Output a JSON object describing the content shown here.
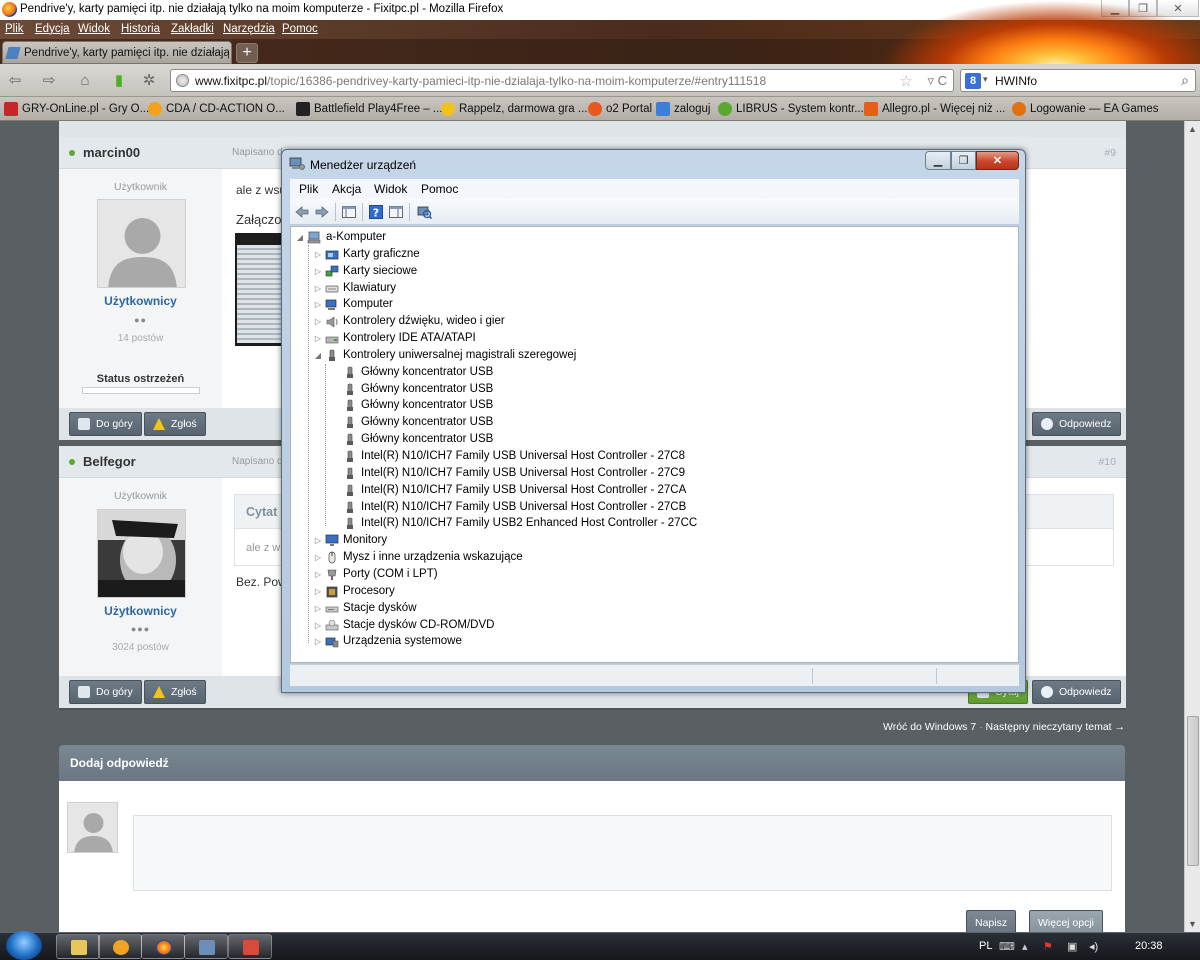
{
  "browser": {
    "window_title": "Pendrive'y, karty pamięci itp. nie działają tylko na moim komputerze - Fixitpc.pl - Mozilla Firefox",
    "menu": [
      "Plik",
      "Edycja",
      "Widok",
      "Historia",
      "Zakładki",
      "Narzędzia",
      "Pomoc"
    ],
    "tab_title": "Pendrive'y, karty pamięci itp. nie działają...",
    "new_tab": "+",
    "url_domain": "www.fixitpc.pl",
    "url_path": "/topic/16386-pendrivey-karty-pamieci-itp-nie-dzialaja-tylko-na-moim-komputerze/#entry111518",
    "search_engine_letter": "8",
    "search_text": "HWINfo",
    "bookmarks": [
      {
        "label": "GRY-OnLine.pl - Gry O...",
        "color": "#c62828"
      },
      {
        "label": "CDA / CD-ACTION O...",
        "color": "#f0a21f"
      },
      {
        "label": "Battlefield Play4Free – ...",
        "color": "#222222"
      },
      {
        "label": "Rappelz, darmowa gra ...",
        "color": "#f3c21a"
      },
      {
        "label": "o2 Portal",
        "color": "#e8571c"
      },
      {
        "label": "zaloguj",
        "color": "#3c7fd6"
      },
      {
        "label": "LIBRUS - System kontr...",
        "color": "#5aa832"
      },
      {
        "label": "Allegro.pl - Więcej niż ...",
        "color": "#e65f1a"
      },
      {
        "label": "Logowanie — EA Games",
        "color": "#e07010"
      }
    ]
  },
  "forum": {
    "posts": [
      {
        "username": "marcin00",
        "posted": "Napisano d",
        "number": "#9",
        "role": "Użytkownik",
        "group": "Użytkownicy",
        "pips": "●●",
        "post_count": "14 postów",
        "status_label": "Status ostrzeżeń",
        "text": "ale z wsu",
        "attach_label": "Załączo"
      },
      {
        "username": "Belfegor",
        "posted": "Napisano d",
        "number": "#10",
        "role": "Użytkownik",
        "group": "Użytkownicy",
        "pips": "●●●",
        "post_count": "3024 postów",
        "quote_label": "Cytat",
        "quote_text": "ale z w",
        "text": "Bez. Pow"
      }
    ],
    "btn_top": "Do góry",
    "btn_report": "Zgłoś",
    "btn_reply": "Odpowiedz",
    "btn_quote": "Cytuj",
    "nav_back": "Wróć do Windows 7",
    "nav_next": "Następny nieczytany temat →",
    "reply_title": "Dodaj odpowiedź",
    "btn_post": "Napisz",
    "btn_more": "Więcej opcji"
  },
  "devmgr": {
    "title": "Menedżer urządzeń",
    "menu": [
      "Plik",
      "Akcja",
      "Widok",
      "Pomoc"
    ],
    "root": "a-Komputer",
    "categories_before": [
      {
        "label": "Karty graficzne",
        "icon": "display-adapter-icon"
      },
      {
        "label": "Karty sieciowe",
        "icon": "network-adapter-icon"
      },
      {
        "label": "Klawiatury",
        "icon": "keyboard-icon"
      },
      {
        "label": "Komputer",
        "icon": "computer-icon"
      },
      {
        "label": "Kontrolery dźwięku, wideo i gier",
        "icon": "sound-icon"
      },
      {
        "label": "Kontrolery IDE ATA/ATAPI",
        "icon": "ide-icon"
      }
    ],
    "usb_category": "Kontrolery uniwersalnej magistrali szeregowej",
    "usb_children": [
      "Główny koncentrator USB",
      "Główny koncentrator USB",
      "Główny koncentrator USB",
      "Główny koncentrator USB",
      "Główny koncentrator USB",
      "Intel(R) N10/ICH7 Family USB Universal Host Controller - 27C8",
      "Intel(R) N10/ICH7 Family USB Universal Host Controller - 27C9",
      "Intel(R) N10/ICH7 Family USB Universal Host Controller - 27CA",
      "Intel(R) N10/ICH7 Family USB Universal Host Controller - 27CB",
      "Intel(R) N10/ICH7 Family USB2 Enhanced Host Controller - 27CC"
    ],
    "categories_after": [
      {
        "label": "Monitory",
        "icon": "monitor-icon"
      },
      {
        "label": "Mysz i inne urządzenia wskazujące",
        "icon": "mouse-icon"
      },
      {
        "label": "Porty (COM i LPT)",
        "icon": "port-icon"
      },
      {
        "label": "Procesory",
        "icon": "processor-icon"
      },
      {
        "label": "Stacje dysków",
        "icon": "disk-drive-icon"
      },
      {
        "label": "Stacje dysków CD-ROM/DVD",
        "icon": "cdrom-icon"
      },
      {
        "label": "Urządzenia systemowe",
        "icon": "system-devices-icon"
      }
    ]
  },
  "taskbar": {
    "lang": "PL",
    "time": "20:38"
  }
}
